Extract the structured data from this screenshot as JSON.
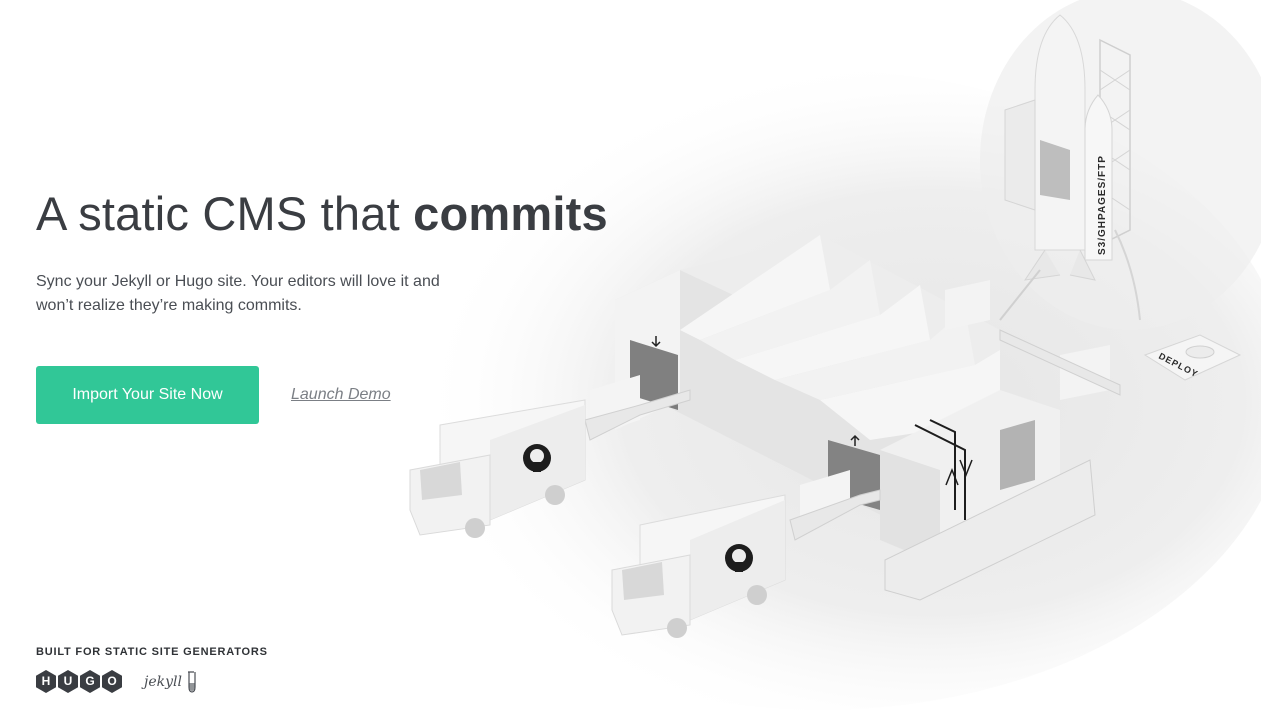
{
  "hero": {
    "headline_light": "A static CMS that ",
    "headline_bold": "commits",
    "subtitle": "Sync your Jekyll or Hugo site. Your editors will love it and won’t realize they’re making commits."
  },
  "actions": {
    "primary_label": "Import Your Site Now",
    "secondary_label": "Launch Demo"
  },
  "footer": {
    "title": "BUILT FOR STATIC SITE GENERATORS",
    "hugo_letters": [
      "H",
      "U",
      "G",
      "O"
    ],
    "jekyll_text": "jekyll"
  },
  "illustration": {
    "rocket_label": "S3/GHPAGES/FTP",
    "deploy_label": "DEPLOY",
    "truck_icon": "github-octocat-icon"
  },
  "colors": {
    "accent": "#31c797",
    "text": "#3a3d42",
    "hugo_hex": "#3a3d42"
  }
}
